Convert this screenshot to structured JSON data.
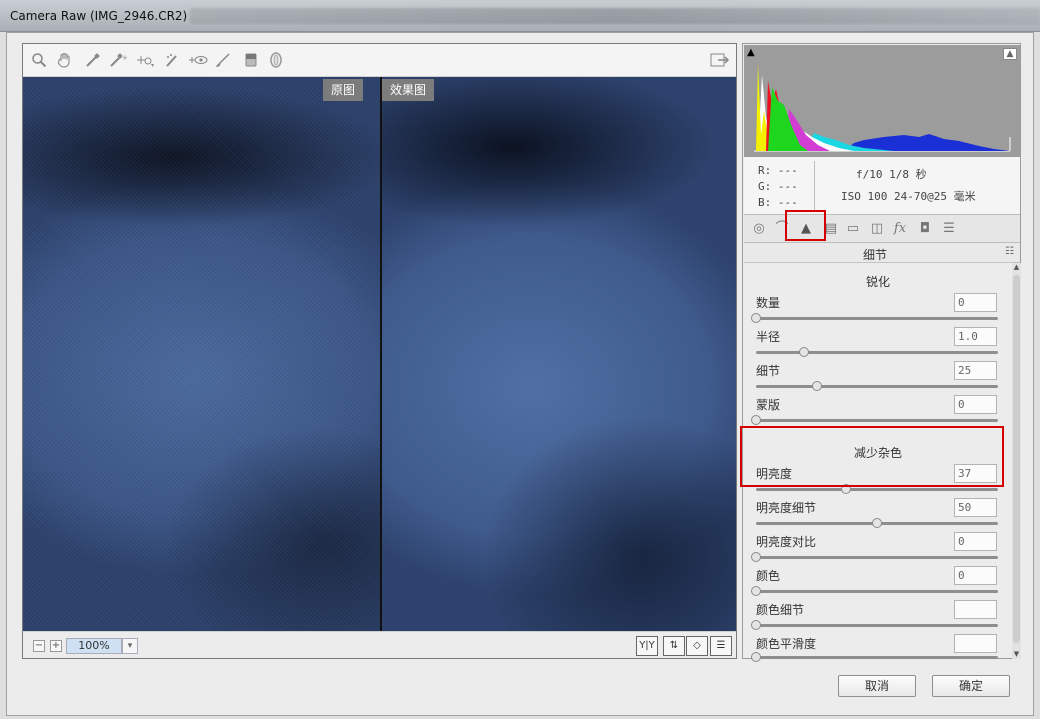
{
  "window": {
    "title": "Camera Raw (IMG_2946.CR2)"
  },
  "toolbar": {
    "tools": [
      "zoom-icon",
      "hand-icon",
      "white-balance-icon",
      "color-sampler-icon",
      "targeted-adjust-icon",
      "spot-removal-icon",
      "red-eye-icon",
      "adjustment-brush-icon",
      "graduated-filter-icon",
      "radial-filter-icon"
    ],
    "exit_icon": "export-icon"
  },
  "preview": {
    "before_label": "原图",
    "after_label": "效果图"
  },
  "statusbar": {
    "zoom": "100%"
  },
  "info": {
    "r": "R:  ---",
    "g": "G:  ---",
    "b": "B:  ---",
    "aperture_shutter": "f/10   1/8 秒",
    "iso_lens": "ISO 100   24-70@25 毫米"
  },
  "panel": {
    "title": "细节"
  },
  "sharpening": {
    "title": "锐化",
    "amount": {
      "label": "数量",
      "value": "0",
      "fraction": 0.0
    },
    "radius": {
      "label": "半径",
      "value": "1.0",
      "fraction": 0.2
    },
    "detail": {
      "label": "细节",
      "value": "25",
      "fraction": 0.25
    },
    "masking": {
      "label": "蒙版",
      "value": "0",
      "fraction": 0.0
    }
  },
  "noise": {
    "title": "减少杂色",
    "luminance": {
      "label": "明亮度",
      "value": "37",
      "fraction": 0.37
    },
    "luminance_detail": {
      "label": "明亮度细节",
      "value": "50",
      "fraction": 0.5
    },
    "luminance_contrast": {
      "label": "明亮度对比",
      "value": "0",
      "fraction": 0.0
    },
    "color": {
      "label": "颜色",
      "value": "0",
      "fraction": 0.0
    },
    "color_detail": {
      "label": "颜色细节",
      "value": "",
      "fraction": 0.0
    },
    "color_smoothness": {
      "label": "颜色平滑度",
      "value": "",
      "fraction": 0.0
    }
  },
  "buttons": {
    "cancel": "取消",
    "ok": "确定"
  },
  "colors": {
    "highlight_red": "#d40000"
  }
}
